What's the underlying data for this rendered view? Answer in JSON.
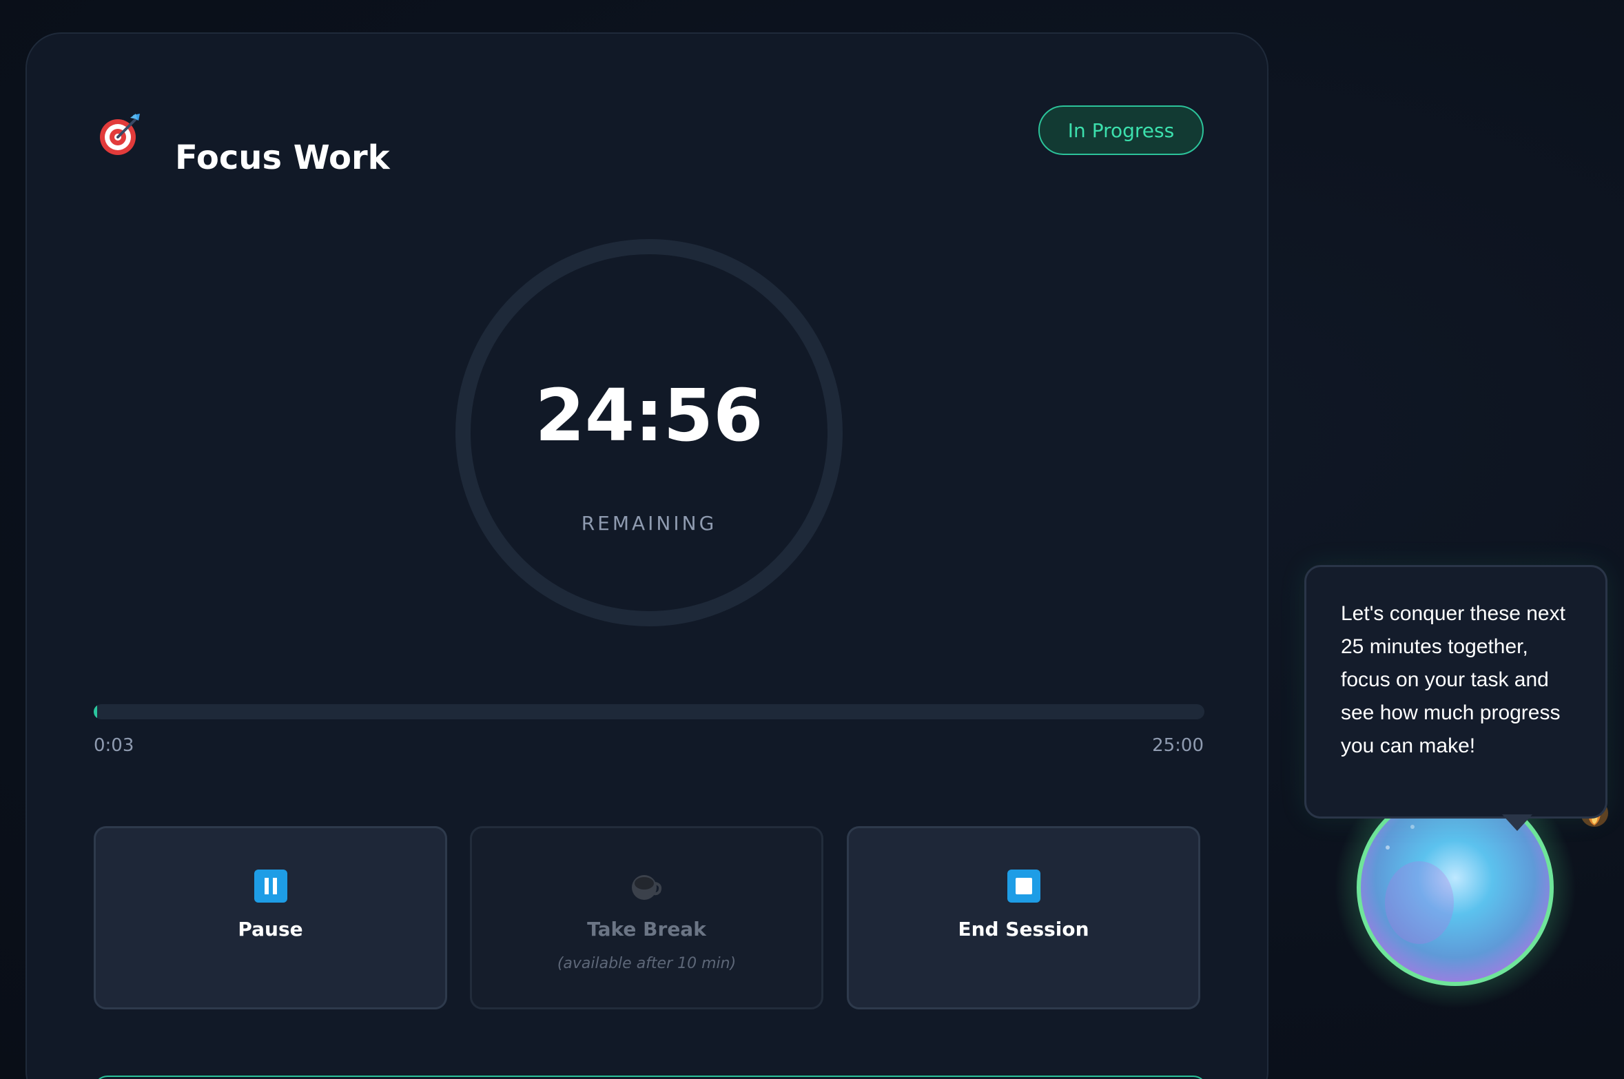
{
  "header": {
    "icon": "target-icon",
    "title": "Focus Work",
    "status": "In Progress"
  },
  "timer": {
    "time_remaining": "24:56",
    "remaining_label": "REMAINING",
    "elapsed": "0:03",
    "total": "25:00",
    "progress_fraction": 0.002
  },
  "actions": [
    {
      "icon": "pause-icon",
      "label": "Pause",
      "note": "",
      "enabled": true
    },
    {
      "icon": "coffee-icon",
      "label": "Take Break",
      "note": "(available after 10 min)",
      "enabled": false
    },
    {
      "icon": "stop-icon",
      "label": "End Session",
      "note": "",
      "enabled": true
    }
  ],
  "companion": {
    "message": "Let's conquer these next 25 minutes together, focus on your task and see how much progress you can make!"
  },
  "colors": {
    "accent": "#2cc39a",
    "button_icon": "#1e9de6",
    "background": "#0b111c",
    "card": "#111927"
  }
}
